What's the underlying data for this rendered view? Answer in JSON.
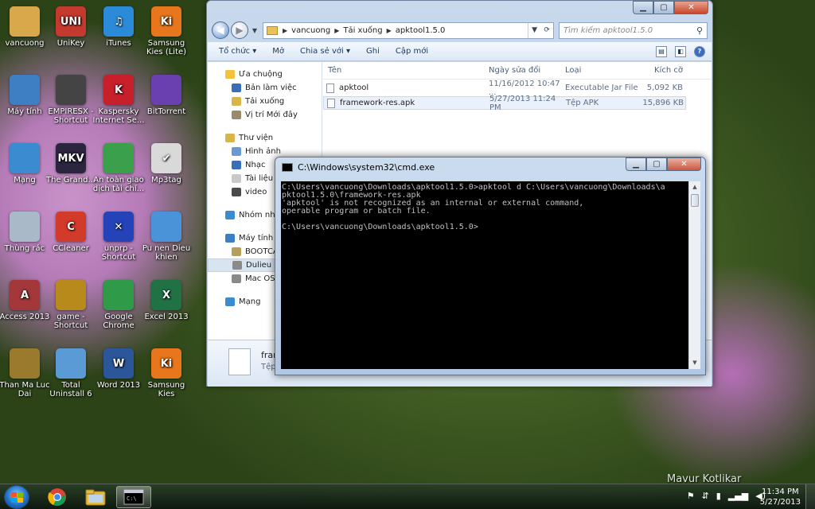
{
  "desktop": {
    "icons": [
      {
        "label": "vancuong",
        "icon": "user-folder-icon",
        "color": "#d9a84a"
      },
      {
        "label": "UniKey",
        "icon": "unikey-icon",
        "color": "#c43a2e"
      },
      {
        "label": "iTunes",
        "icon": "itunes-icon",
        "color": "#2c8bd8"
      },
      {
        "label": "Samsung Kies (Lite)",
        "icon": "samsung-kies-lite-icon",
        "color": "#e8761c"
      },
      {
        "label": "Máy tính",
        "icon": "computer-icon",
        "color": "#3d7fc2"
      },
      {
        "label": "EMPIRESX - Shortcut",
        "icon": "empires-icon",
        "color": "#444"
      },
      {
        "label": "Kaspersky Internet Se...",
        "icon": "kaspersky-icon",
        "color": "#c8202a"
      },
      {
        "label": "BitTorrent",
        "icon": "bittorrent-icon",
        "color": "#6a3fb0"
      },
      {
        "label": "Mạng",
        "icon": "network-icon",
        "color": "#3a8bd0"
      },
      {
        "label": "The Grand...",
        "icon": "mkv-icon",
        "color": "#2b2540"
      },
      {
        "label": "An toàn giao dịch tài chí...",
        "icon": "bank-card-icon",
        "color": "#3aa04c"
      },
      {
        "label": "Mp3tag",
        "icon": "mp3tag-icon",
        "color": "#d9d9d9"
      },
      {
        "label": "Thùng rác",
        "icon": "recycle-bin-icon",
        "color": "#a9b9c8"
      },
      {
        "label": "CCleaner",
        "icon": "ccleaner-icon",
        "color": "#d23a2a"
      },
      {
        "label": "unprp - Shortcut",
        "icon": "unprp-icon",
        "color": "#2443b8"
      },
      {
        "label": "Pu nen Dieu khien",
        "icon": "control-panel-icon",
        "color": "#4a93d9"
      },
      {
        "label": "Access 2013",
        "icon": "access-icon",
        "color": "#a4373a"
      },
      {
        "label": "game - Shortcut",
        "icon": "game-icon",
        "color": "#b88a1c"
      },
      {
        "label": "Google Chrome",
        "icon": "chrome-icon",
        "color": "#2f9a48"
      },
      {
        "label": "Excel 2013",
        "icon": "excel-icon",
        "color": "#207245"
      },
      {
        "label": "Than Ma Luc Dai",
        "icon": "game-shield-icon",
        "color": "#9a7a2c"
      },
      {
        "label": "Total Uninstall 6",
        "icon": "total-uninstall-icon",
        "color": "#5b9bd5"
      },
      {
        "label": "Word 2013",
        "icon": "word-icon",
        "color": "#2b579a"
      },
      {
        "label": "Samsung Kies",
        "icon": "samsung-kies-icon",
        "color": "#e8761c"
      }
    ],
    "icon_glyphs": [
      "",
      "UNI",
      "♫",
      "Ki",
      "",
      "",
      "K",
      "",
      "",
      "MKV",
      "",
      "✔",
      "",
      "C",
      "✕",
      "",
      "A",
      "",
      "",
      "X",
      "",
      "",
      "W",
      "Ki"
    ],
    "watermark": "Mavur Kotlikar"
  },
  "explorer": {
    "address": {
      "segments": [
        "vancuong",
        "Tải xuống",
        "apktool1.5.0"
      ]
    },
    "search_placeholder": "Tìm kiếm apktool1.5.0",
    "toolbar": [
      "Tổ chức ▾",
      "Mở",
      "Chia sẻ với ▾",
      "Ghi",
      "Cập mới"
    ],
    "nav_pane": [
      {
        "label": "Ưa chuộng",
        "icon": "star-icon",
        "group": true,
        "color": "#f2c23a"
      },
      {
        "label": "Bản làm việc",
        "icon": "desktop-icon",
        "color": "#3a6fb8"
      },
      {
        "label": "Tải xuống",
        "icon": "downloads-folder-icon",
        "color": "#d9b44a"
      },
      {
        "label": "Vị trí Mới đây",
        "icon": "recent-places-icon",
        "color": "#9a8a6a"
      },
      {
        "label": "Thư viện",
        "icon": "libraries-icon",
        "group": true,
        "gap": true,
        "color": "#d9b44a"
      },
      {
        "label": "Hình ảnh",
        "icon": "pictures-icon",
        "color": "#6a9ad0"
      },
      {
        "label": "Nhạc",
        "icon": "music-icon",
        "color": "#3a6fb8"
      },
      {
        "label": "Tài liệu",
        "icon": "documents-icon",
        "color": "#c9c9c9"
      },
      {
        "label": "video",
        "icon": "video-icon",
        "color": "#4a4a4a"
      },
      {
        "label": "Nhóm nhà",
        "icon": "homegroup-icon",
        "group": true,
        "gap": true,
        "color": "#3a8bd0"
      },
      {
        "label": "Máy tính",
        "icon": "computer-icon",
        "group": true,
        "gap": true,
        "color": "#3d7fc2"
      },
      {
        "label": "BOOTCA",
        "icon": "drive-icon",
        "color": "#b5a05a"
      },
      {
        "label": "Dulieu (D",
        "icon": "drive-icon",
        "selected": true,
        "color": "#8a8a8a"
      },
      {
        "label": "Mac OSX",
        "icon": "drive-icon",
        "color": "#8a8a8a"
      },
      {
        "label": "Mạng",
        "icon": "network-icon",
        "group": true,
        "gap": true,
        "color": "#3a8bd0"
      }
    ],
    "columns": {
      "name": "Tên",
      "date": "Ngày sửa đổi",
      "type": "Loại",
      "size": "Kích cỡ"
    },
    "files": [
      {
        "name": "apktool",
        "date": "11/16/2012 10:47 ...",
        "type": "Executable Jar File",
        "size": "5,092 KB"
      },
      {
        "name": "framework-res.apk",
        "date": "5/27/2013 11:24 PM",
        "type": "Tệp APK",
        "size": "15,896 KB",
        "selected": true
      }
    ],
    "details": {
      "name": "fram",
      "type": "Tệp"
    }
  },
  "cmd": {
    "title": "C:\\Windows\\system32\\cmd.exe",
    "output": "C:\\Users\\vancuong\\Downloads\\apktool1.5.0>apktool d C:\\Users\\vancuong\\Downloads\\a\npktool1.5.0\\framework-res.apk\n'apktool' is not recognized as an internal or external command,\noperable program or batch file.\n\nC:\\Users\\vancuong\\Downloads\\apktool1.5.0>"
  },
  "taskbar": {
    "apps": [
      {
        "name": "chrome",
        "icon": "chrome-icon"
      },
      {
        "name": "explorer",
        "icon": "folder-icon"
      },
      {
        "name": "cmd",
        "icon": "cmd-icon",
        "active": true
      }
    ],
    "time": "11:34 PM",
    "date": "5/27/2013"
  }
}
